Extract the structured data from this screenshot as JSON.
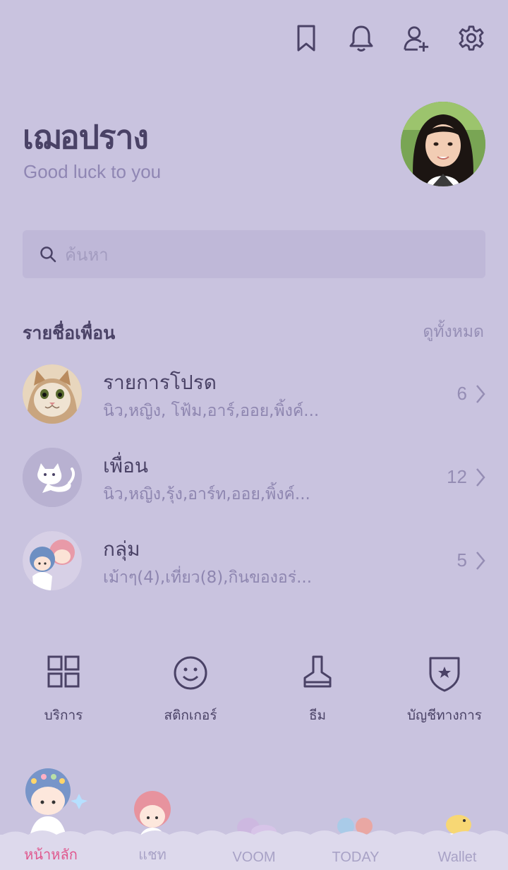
{
  "header": {
    "icons": [
      "bookmark-icon",
      "bell-icon",
      "add-friend-icon",
      "settings-icon"
    ]
  },
  "profile": {
    "name": "เฌอปราง",
    "status": "Good luck to you"
  },
  "search": {
    "placeholder": "ค้นหา"
  },
  "friends_section": {
    "title": "รายชื่อเพื่อน",
    "see_all": "ดูทั้งหมด",
    "rows": [
      {
        "title": "รายการโปรด",
        "subtitle": "นิว,หญิง, โฟ้ม,อาร์,ออย,พิ้งค์...",
        "count": "6"
      },
      {
        "title": "เพื่อน",
        "subtitle": "นิว,หญิง,รุ้ง,อาร์ท,ออย,พิ้งค์...",
        "count": "12"
      },
      {
        "title": "กลุ่ม",
        "subtitle": "เม้าๆ(4),เที่ยว(8),กินของอร่...",
        "count": "5"
      }
    ]
  },
  "shortcuts": [
    {
      "label": "บริการ",
      "icon": "grid-icon"
    },
    {
      "label": "สติกเกอร์",
      "icon": "smiley-icon"
    },
    {
      "label": "ธีม",
      "icon": "brush-icon"
    },
    {
      "label": "บัญชีทางการ",
      "icon": "shield-star-icon"
    }
  ],
  "tabs": [
    {
      "label": "หน้าหลัก",
      "active": true
    },
    {
      "label": "แชท",
      "active": false
    },
    {
      "label": "VOOM",
      "active": false
    },
    {
      "label": "TODAY",
      "active": false
    },
    {
      "label": "Wallet",
      "active": false
    }
  ],
  "colors": {
    "background": "#c9c3df",
    "accent": "#e0588e",
    "text": "#4a4266"
  }
}
